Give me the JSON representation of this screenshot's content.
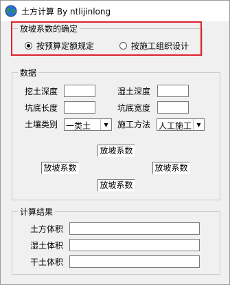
{
  "window": {
    "title": "土方计算 By ntlijinlong"
  },
  "slope_method": {
    "legend": "放坡系数的确定",
    "options": [
      {
        "label": "按预算定额规定",
        "checked": true
      },
      {
        "label": "按施工组织设计",
        "checked": false
      }
    ]
  },
  "data_section": {
    "legend": "数据",
    "excavation_depth": {
      "label": "挖土深度",
      "value": ""
    },
    "wet_depth": {
      "label": "湿土深度",
      "value": ""
    },
    "pit_length": {
      "label": "坑底长度",
      "value": ""
    },
    "pit_width": {
      "label": "坑底宽度",
      "value": ""
    },
    "soil_type": {
      "label": "土壤类别",
      "selected": "一类土"
    },
    "construction_method": {
      "label": "施工方法",
      "selected": "人工施工"
    },
    "coefficients": {
      "top": "放坡系数",
      "left": "放坡系数",
      "right": "放坡系数",
      "bottom": "放坡系数"
    }
  },
  "results": {
    "legend": "计算结果",
    "earth_volume": {
      "label": "土方体积",
      "value": ""
    },
    "wet_volume": {
      "label": "湿土体积",
      "value": ""
    },
    "dry_volume": {
      "label": "干土体积",
      "value": ""
    }
  }
}
